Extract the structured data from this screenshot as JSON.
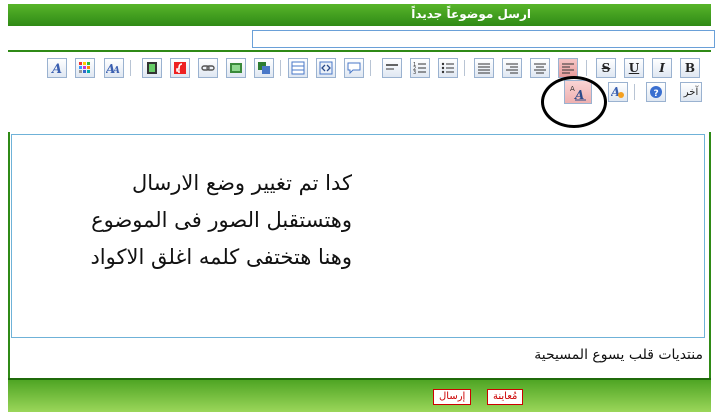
{
  "title": "ارسل موضوعاً جديداً",
  "subject": {
    "value": ""
  },
  "toolbar": {
    "bold": "B",
    "italic": "I",
    "underline": "U",
    "strike": "S",
    "other_label": "آخر"
  },
  "editor": {
    "lines": [
      "كدا تم تغيير وضع الارسال",
      "وهتستقبل الصور فى الموضوع",
      "وهنا هتختفى كلمه اغلق الاكواد"
    ]
  },
  "footer_note": "منتديات قلب يسوع المسيحية",
  "buttons": {
    "preview": "مُعاينة",
    "send": "إرسال"
  },
  "colors": {
    "header_green": "#2f8a16",
    "accent_blue": "#6aa0d8"
  }
}
